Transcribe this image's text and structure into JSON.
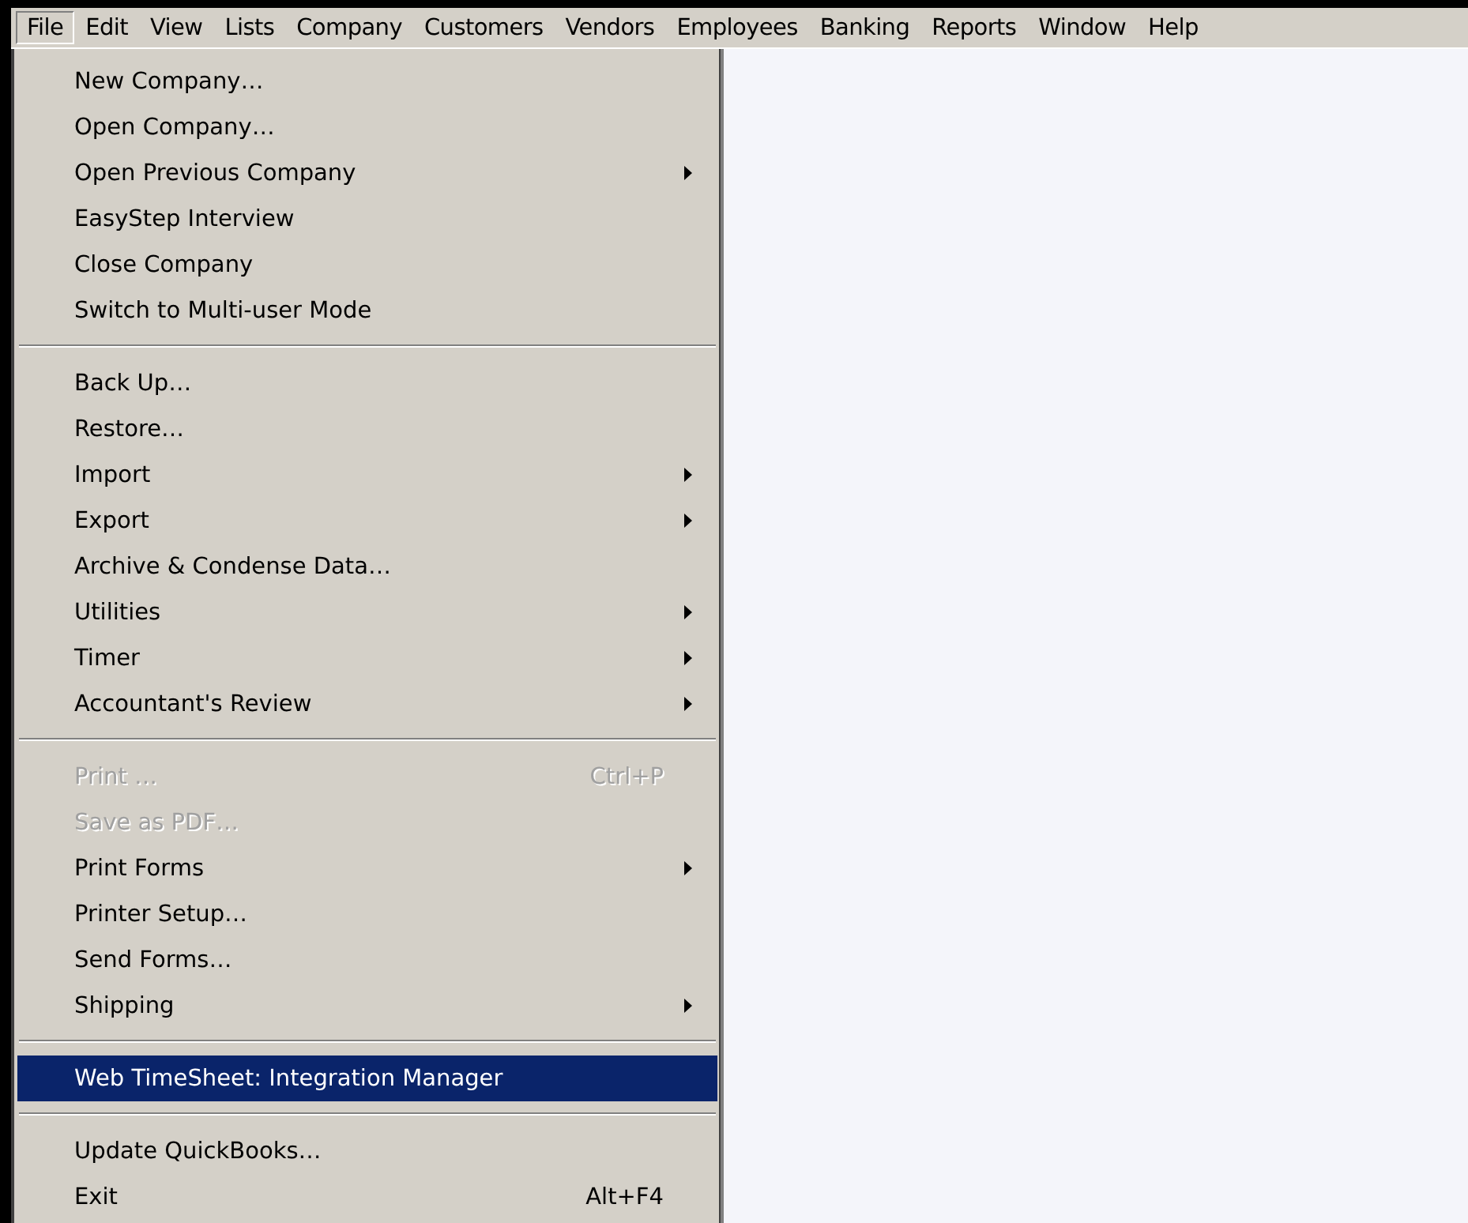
{
  "menu_bar": [
    {
      "label": "File",
      "selected": true
    },
    {
      "label": "Edit",
      "selected": false
    },
    {
      "label": "View",
      "selected": false
    },
    {
      "label": "Lists",
      "selected": false
    },
    {
      "label": "Company",
      "selected": false
    },
    {
      "label": "Customers",
      "selected": false
    },
    {
      "label": "Vendors",
      "selected": false
    },
    {
      "label": "Employees",
      "selected": false
    },
    {
      "label": "Banking",
      "selected": false
    },
    {
      "label": "Reports",
      "selected": false
    },
    {
      "label": "Window",
      "selected": false
    },
    {
      "label": "Help",
      "selected": false
    }
  ],
  "file_menu": {
    "groups": [
      [
        {
          "label": "New Company…",
          "disabled": false,
          "selected": false,
          "submenu": false
        },
        {
          "label": "Open Company…",
          "disabled": false,
          "selected": false,
          "submenu": false
        },
        {
          "label": "Open Previous Company",
          "disabled": false,
          "selected": false,
          "submenu": true
        },
        {
          "label": "EasyStep Interview",
          "disabled": false,
          "selected": false,
          "submenu": false
        },
        {
          "label": "Close Company",
          "disabled": false,
          "selected": false,
          "submenu": false
        },
        {
          "label": "Switch to Multi-user Mode",
          "disabled": false,
          "selected": false,
          "submenu": false
        }
      ],
      [
        {
          "label": "Back Up…",
          "disabled": false,
          "selected": false,
          "submenu": false
        },
        {
          "label": "Restore…",
          "disabled": false,
          "selected": false,
          "submenu": false
        },
        {
          "label": "Import",
          "disabled": false,
          "selected": false,
          "submenu": true
        },
        {
          "label": "Export",
          "disabled": false,
          "selected": false,
          "submenu": true
        },
        {
          "label": "Archive & Condense Data…",
          "disabled": false,
          "selected": false,
          "submenu": false
        },
        {
          "label": "Utilities",
          "disabled": false,
          "selected": false,
          "submenu": true
        },
        {
          "label": "Timer",
          "disabled": false,
          "selected": false,
          "submenu": true
        },
        {
          "label": "Accountant's Review",
          "disabled": false,
          "selected": false,
          "submenu": true
        }
      ],
      [
        {
          "label": "Print …",
          "shortcut": "Ctrl+P",
          "disabled": true,
          "selected": false,
          "submenu": false
        },
        {
          "label": "Save as PDF…",
          "disabled": true,
          "selected": false,
          "submenu": false
        },
        {
          "label": "Print Forms",
          "disabled": false,
          "selected": false,
          "submenu": true
        },
        {
          "label": "Printer Setup…",
          "disabled": false,
          "selected": false,
          "submenu": false
        },
        {
          "label": "Send Forms…",
          "disabled": false,
          "selected": false,
          "submenu": false
        },
        {
          "label": "Shipping",
          "disabled": false,
          "selected": false,
          "submenu": true
        }
      ],
      [
        {
          "label": "Web TimeSheet: Integration Manager",
          "disabled": false,
          "selected": true,
          "submenu": false
        }
      ],
      [
        {
          "label": "Update QuickBooks…",
          "disabled": false,
          "selected": false,
          "submenu": false
        },
        {
          "label": "Exit",
          "shortcut": "Alt+F4",
          "disabled": false,
          "selected": false,
          "submenu": false
        }
      ]
    ]
  }
}
